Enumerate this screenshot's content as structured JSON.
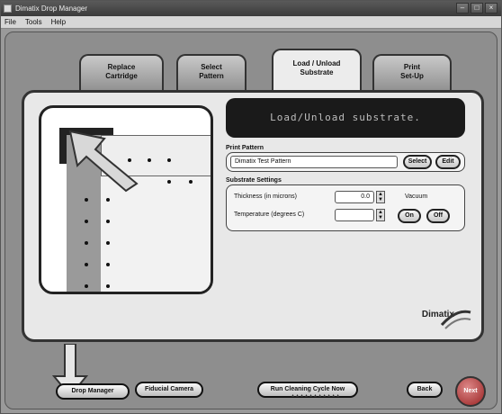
{
  "window": {
    "title": "Dimatix Drop Manager"
  },
  "menu": {
    "items": [
      "File",
      "Tools",
      "Help"
    ]
  },
  "tabs": [
    {
      "label": "Replace\nCartridge"
    },
    {
      "label": "Select\nPattern"
    },
    {
      "label": "Load / Unload\nSubstrate"
    },
    {
      "label": "Print\nSet-Up"
    }
  ],
  "prompt": {
    "text": "Load/Unload substrate."
  },
  "print_pattern": {
    "section_label": "Print Pattern",
    "value": "Dimatix Test Pattern",
    "select_label": "Select",
    "edit_label": "Edit"
  },
  "substrate_settings": {
    "section_label": "Substrate Settings",
    "thickness_label": "Thickness (in microns)",
    "thickness_value": "0.0",
    "temperature_label": "Temperature (degrees C)",
    "temperature_value": "",
    "vacuum_label": "Vacuum",
    "on_label": "On",
    "off_label": "Off"
  },
  "logo": {
    "text": "Dimatix"
  },
  "bottom": {
    "drop_manager_label": "Drop Manager",
    "fiducial_camera_label": "Fiducial Camera",
    "run_cleaning_label": "Run Cleaning Cycle Now",
    "back_label": "Back",
    "next_label": "Next"
  },
  "colors": {
    "next_button": "#992222",
    "prompt_bg": "#1a1a1a"
  }
}
